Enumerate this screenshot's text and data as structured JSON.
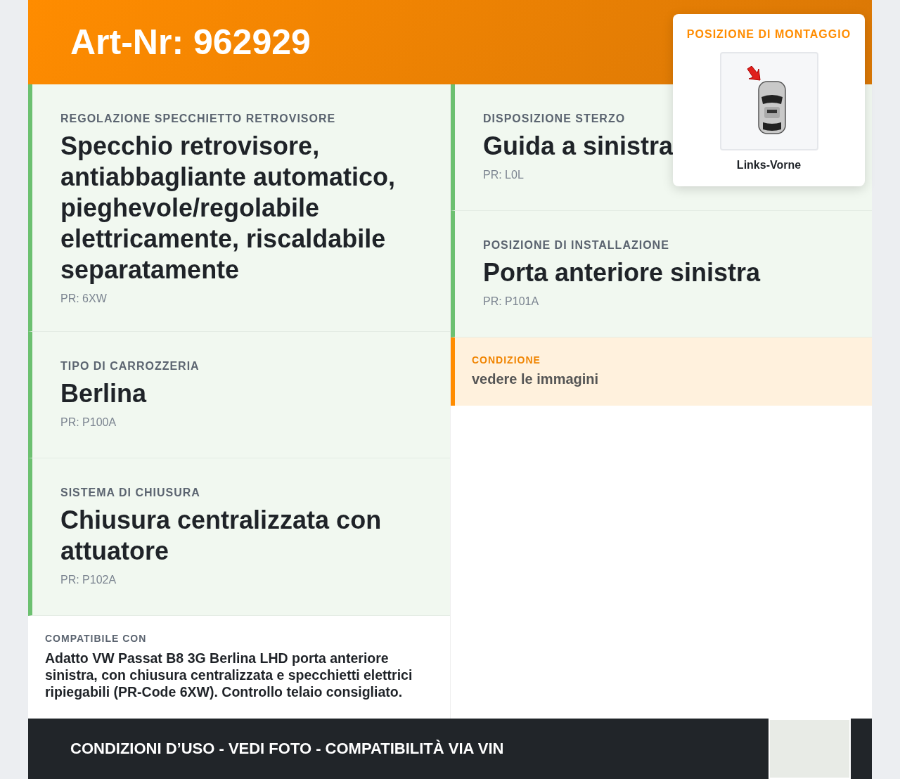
{
  "header": {
    "title": "Art-Nr: 962929"
  },
  "mounting": {
    "title": "POSIZIONE DI MONTAGGIO",
    "caption": "Links-Vorne"
  },
  "left_fields": [
    {
      "label": "REGOLAZIONE SPECCHIETTO RETROVISORE",
      "value": "Specchio retrovisore, antiabbagliante automatico, pieghevole/regolabile elettricamente, riscaldabile separatamente",
      "code": "PR: 6XW"
    },
    {
      "label": "TIPO DI CARROZZERIA",
      "value": "Berlina",
      "code": "PR: P100A"
    },
    {
      "label": "SISTEMA DI CHIUSURA",
      "value": "Chiusura centralizzata con attuatore",
      "code": "PR: P102A"
    }
  ],
  "right_fields": [
    {
      "label": "DISPOSIZIONE STERZO",
      "value": "Guida a sinistra",
      "code": "PR: L0L"
    },
    {
      "label": "POSIZIONE DI INSTALLAZIONE",
      "value": "Porta anteriore sinistra",
      "code": "PR: P101A"
    }
  ],
  "condition": {
    "label": "CONDIZIONE",
    "value": "vedere le immagini"
  },
  "compatibility": {
    "label": "COMPATIBILE CON",
    "text": "Adatto VW Passat B8 3G Berlina LHD porta anteriore sinistra, con chiusura centralizzata e specchietti elettrici ripiegabili (PR-Code 6XW). Controllo telaio consigliato."
  },
  "footer": {
    "text": "CONDIZIONI D’USO - VEDI FOTO - COMPATIBILITÀ VIA VIN"
  }
}
